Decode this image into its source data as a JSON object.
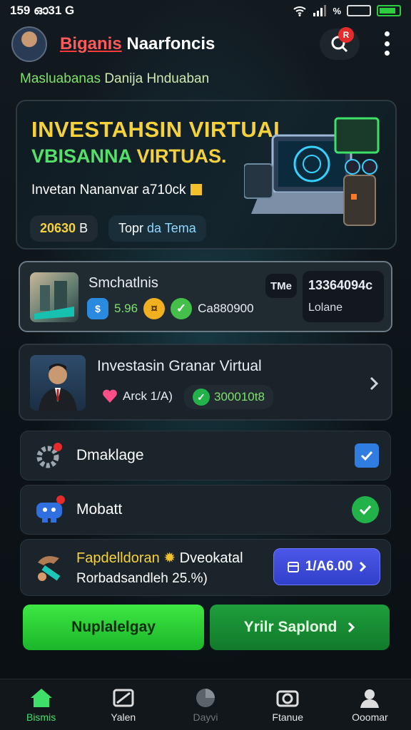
{
  "status": {
    "time": "159 ഓ31 G",
    "signal_text": "%"
  },
  "header": {
    "brand": "Biganis",
    "title_rest": "Naarfoncis",
    "badge": "R"
  },
  "subtitle": {
    "part1": "Masluabanas",
    "part2": "Danija Hnduaban"
  },
  "hero": {
    "title1": "INVESTAHSIN VIRTUAL",
    "title2_green": "VBISANNA",
    "title2_yellow": "VIRTUAS.",
    "desc": "Invetan Nananvar a710ck",
    "pill_value": "20630",
    "pill_suffix": "B",
    "pill2_a": "Topr",
    "pill2_b": "da Tema"
  },
  "card1": {
    "title": "Smchatlnis",
    "stat_a": "5.96",
    "stat_b": "Ca880900",
    "tag": "TMe",
    "box_value": "13364094c",
    "box_label": "Lolane"
  },
  "card2": {
    "title": "Investasin Granar Virtual",
    "chip1": "Arck 1/A)",
    "chip2": "300010t8"
  },
  "rows": {
    "r1": "Dmaklage",
    "r2": "Mobatt",
    "r3_title": "Fapdelldoran",
    "r3_title2": "Dveokatal",
    "r3_sub": "Rorbadsandleh 25.%)",
    "r3_button": "1/A6.00"
  },
  "buttons": {
    "left": "Nuplalelgay",
    "right": "Yrilr Saplond"
  },
  "nav": [
    {
      "label": "Bismis"
    },
    {
      "label": "Yalen"
    },
    {
      "label": "Dayvi"
    },
    {
      "label": "Ftanue"
    },
    {
      "label": "Ooomar"
    }
  ],
  "colors": {
    "accent_green": "#3ee06a",
    "accent_yellow": "#f6d23a",
    "accent_blue": "#4b57e8",
    "alert_red": "#e52b2b"
  }
}
